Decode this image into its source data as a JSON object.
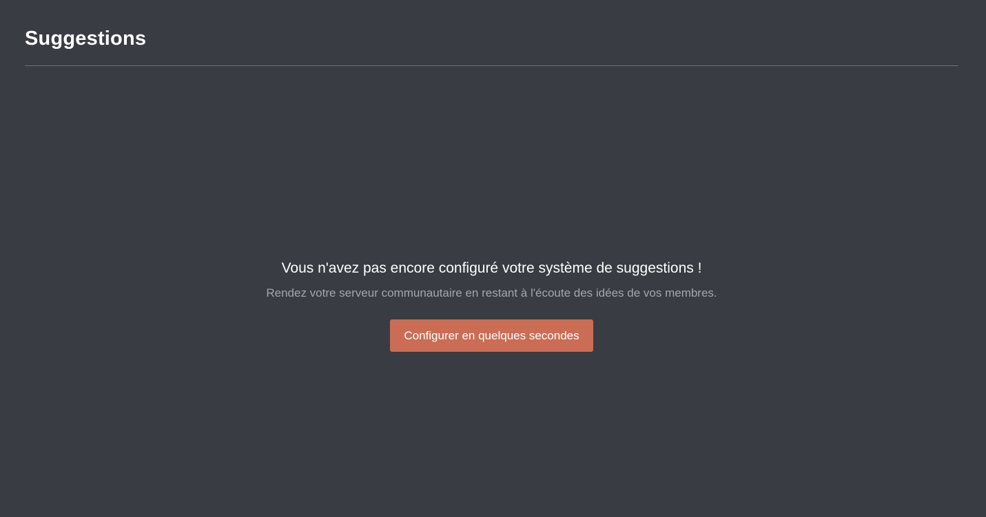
{
  "page": {
    "title": "Suggestions"
  },
  "empty_state": {
    "heading": "Vous n'avez pas encore configuré votre système de suggestions !",
    "subtext": "Rendez votre serveur communautaire en restant à l'écoute des idées de vos membres.",
    "button_label": "Configurer en quelques secondes"
  },
  "colors": {
    "background": "#393c42",
    "accent": "#cb6d54",
    "muted_text": "#a4a6aa",
    "divider": "#6e7177"
  }
}
